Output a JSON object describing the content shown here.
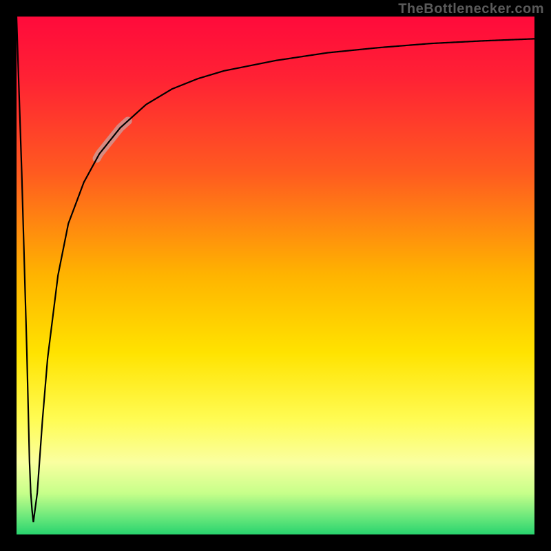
{
  "watermark": {
    "text": "TheBottlenecker.com",
    "color": "#5a5a5a"
  },
  "gradient": {
    "stops": [
      {
        "offset": 0.0,
        "color": "#ff0a3b"
      },
      {
        "offset": 0.12,
        "color": "#ff2234"
      },
      {
        "offset": 0.3,
        "color": "#ff5a20"
      },
      {
        "offset": 0.5,
        "color": "#ffb400"
      },
      {
        "offset": 0.65,
        "color": "#ffe300"
      },
      {
        "offset": 0.78,
        "color": "#fffc55"
      },
      {
        "offset": 0.86,
        "color": "#faffa0"
      },
      {
        "offset": 0.92,
        "color": "#c7ff8a"
      },
      {
        "offset": 0.97,
        "color": "#63e67a"
      },
      {
        "offset": 1.0,
        "color": "#28d36e"
      }
    ]
  },
  "curve": {
    "stroke": "#000000",
    "width": 2.2
  },
  "highlight_segment": {
    "stroke": "#caa0a0",
    "opacity": 0.75,
    "width": 12,
    "x_range": [
      0.155,
      0.215
    ]
  },
  "chart_data": {
    "type": "line",
    "title": "",
    "xlabel": "",
    "ylabel": "",
    "xlim": [
      0,
      1
    ],
    "ylim": [
      0,
      100
    ],
    "legend": false,
    "grid": false,
    "annotations": [],
    "note": "Axes are unlabeled in the source image; x is normalized 0–1 left→right, y is bottleneck percentage (0 at bottom, 100 at top). Values estimated from pixel positions.",
    "series": [
      {
        "name": "bottleneck-curve",
        "x": [
          0.0,
          0.01,
          0.02,
          0.026,
          0.032,
          0.04,
          0.05,
          0.06,
          0.08,
          0.1,
          0.13,
          0.16,
          0.2,
          0.25,
          0.3,
          0.35,
          0.4,
          0.5,
          0.6,
          0.7,
          0.8,
          0.9,
          1.0
        ],
        "y": [
          100.0,
          70.0,
          35.0,
          10.0,
          2.0,
          8.0,
          22.0,
          34.0,
          50.0,
          60.0,
          68.0,
          73.5,
          78.5,
          83.0,
          86.0,
          88.0,
          89.5,
          91.5,
          93.0,
          94.0,
          94.8,
          95.3,
          95.7
        ]
      }
    ],
    "highlight": {
      "series": "bottleneck-curve",
      "x_start": 0.155,
      "x_end": 0.215,
      "style": "thick-pale-overlay"
    }
  }
}
